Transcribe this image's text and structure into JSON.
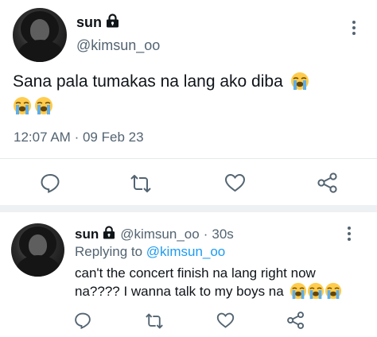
{
  "tweet": {
    "author_name": "sun",
    "author_handle": "@kimsun_oo",
    "text": "Sana pala tumakas na lang ako diba",
    "time": "12:07 AM",
    "separator": "·",
    "date": "09 Feb 23"
  },
  "reply": {
    "author_name": "sun",
    "author_handle": "@kimsun_oo",
    "separator": "·",
    "age": "30s",
    "replying_prefix": "Replying to",
    "replying_to": "@kimsun_oo",
    "text_line1": "can't the concert finish na lang right now",
    "text_line2": "na???? I wanna talk to my boys na"
  },
  "icons": {
    "lock": "lock-icon",
    "more": "more-vertical-icon",
    "reply": "comment-icon",
    "retweet": "retweet-icon",
    "like": "heart-icon",
    "share": "share-icon",
    "emoji": "loudly-crying-face-emoji"
  },
  "colors": {
    "text": "#0f1419",
    "secondary": "#536471",
    "link": "#1d9bf0"
  }
}
